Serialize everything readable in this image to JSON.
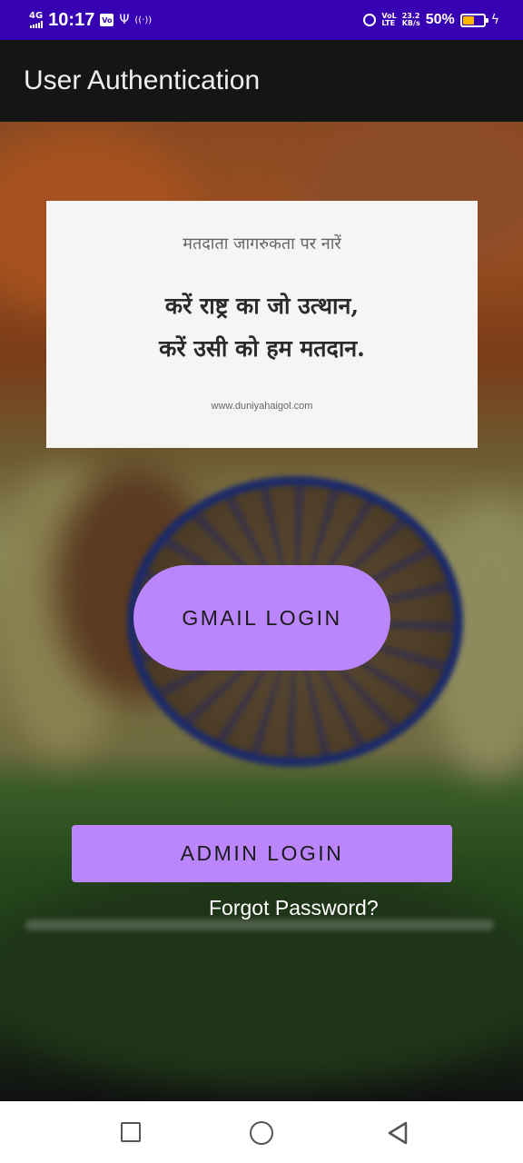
{
  "status_bar": {
    "network": "4G",
    "time": "10:17",
    "vo_badge": "Vo",
    "usb_symbol": "Ψ",
    "hotspot_symbol": "((·))",
    "volte": [
      "VoL",
      "LTE"
    ],
    "speed": [
      "23.2",
      "KB/s"
    ],
    "battery_percent": "50%",
    "battery_level": 0.5,
    "battery_color": "#f9b800",
    "charging_symbol": "ϟ",
    "background_color": "#3700b3"
  },
  "app_bar": {
    "title": "User Authentication"
  },
  "poster": {
    "top_text": "मतदाता जागरुकता पर नारें",
    "line1": "करें राष्ट्र का जो उत्थान,",
    "line2": "करें उसी को हम मतदान.",
    "url": "www.duniyahaigol.com"
  },
  "buttons": {
    "gmail_login": "GMAIL LOGIN",
    "admin_login": "ADMIN LOGIN",
    "forgot_password": "Forgot Password?",
    "accent_color": "#bb86fc"
  },
  "nav_bar": {
    "icons": [
      "recent-apps-icon",
      "home-icon",
      "back-icon"
    ]
  }
}
